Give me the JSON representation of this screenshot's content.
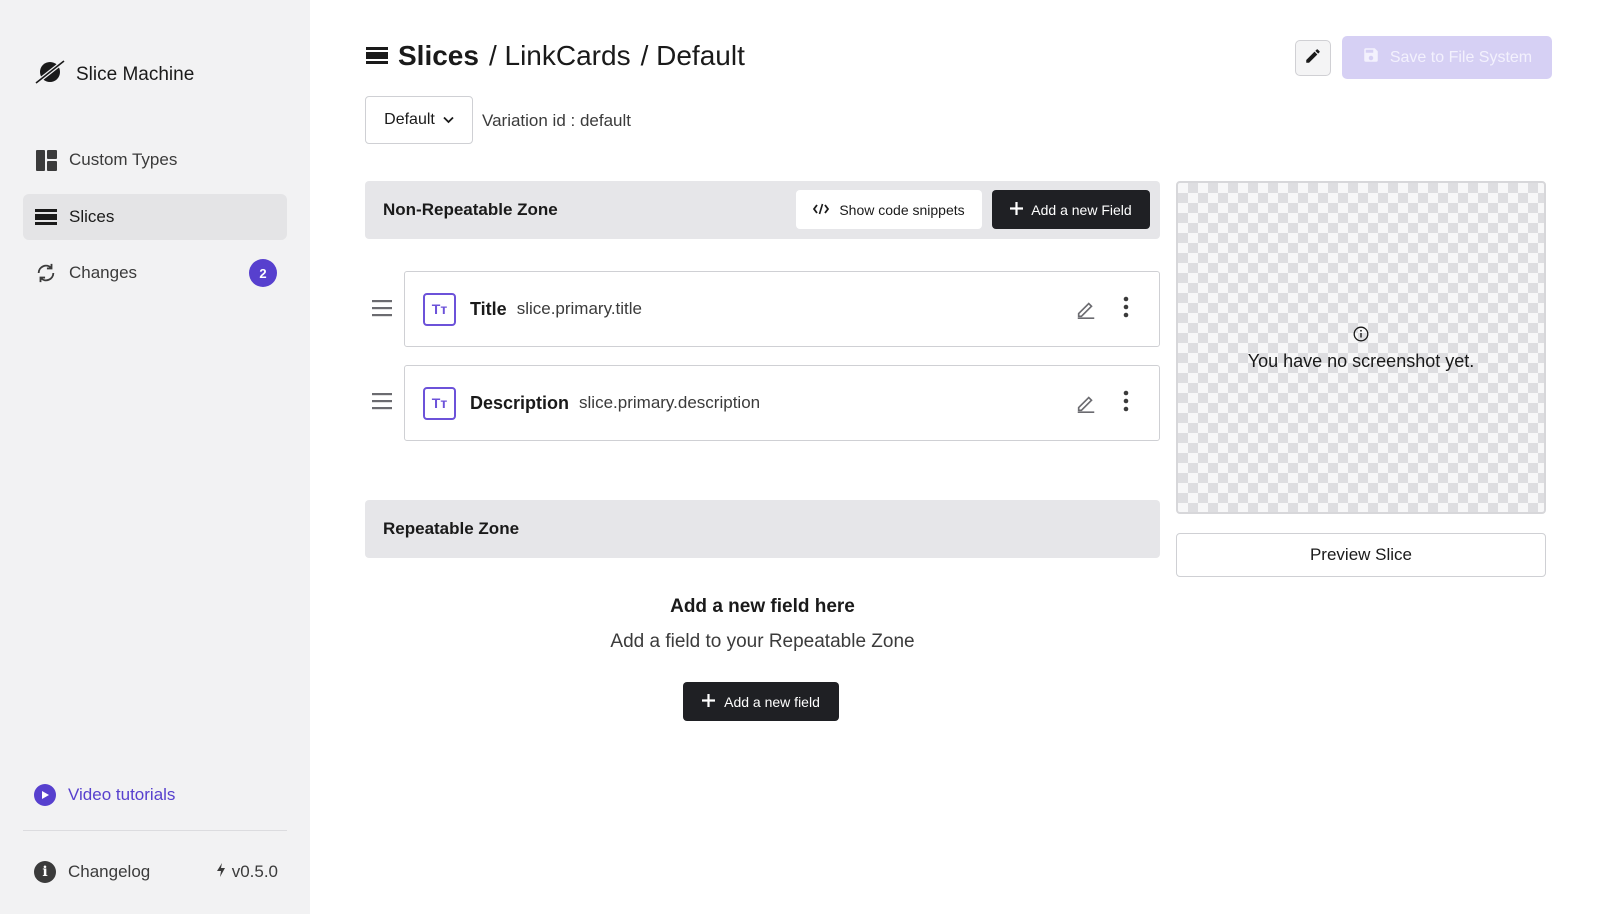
{
  "app": {
    "name": "Slice Machine"
  },
  "sidebar": {
    "items": [
      {
        "label": "Custom Types",
        "icon": "layout-icon"
      },
      {
        "label": "Slices",
        "icon": "slices-icon",
        "active": true
      },
      {
        "label": "Changes",
        "icon": "sync-icon",
        "badge": "2"
      }
    ],
    "video_tutorials": "Video tutorials",
    "changelog": "Changelog",
    "version": "v0.5.0"
  },
  "header": {
    "section": "Slices",
    "slice_name": "/ LinkCards",
    "variation_name": "/ Default",
    "save_label": "Save to File System"
  },
  "variation": {
    "selected": "Default",
    "id_label": "Variation id : default"
  },
  "non_repeatable": {
    "title": "Non-Repeatable Zone",
    "snippets_label": "Show code snippets",
    "add_field_label": "Add a new Field",
    "fields": [
      {
        "label": "Title",
        "key": "slice.primary.title",
        "icon_text": "Tт"
      },
      {
        "label": "Description",
        "key": "slice.primary.description",
        "icon_text": "Tт"
      }
    ]
  },
  "repeatable": {
    "title": "Repeatable Zone",
    "empty_title": "Add a new field here",
    "empty_subtitle": "Add a field to your Repeatable Zone",
    "add_field_label": "Add a new field"
  },
  "screenshot": {
    "message": "You have no screenshot yet.",
    "preview_label": "Preview Slice"
  },
  "colors": {
    "accent": "#5740ce",
    "dark_button": "#1f2024",
    "save_disabled": "#d6d0f4",
    "sidebar_bg": "#f2f2f3"
  }
}
